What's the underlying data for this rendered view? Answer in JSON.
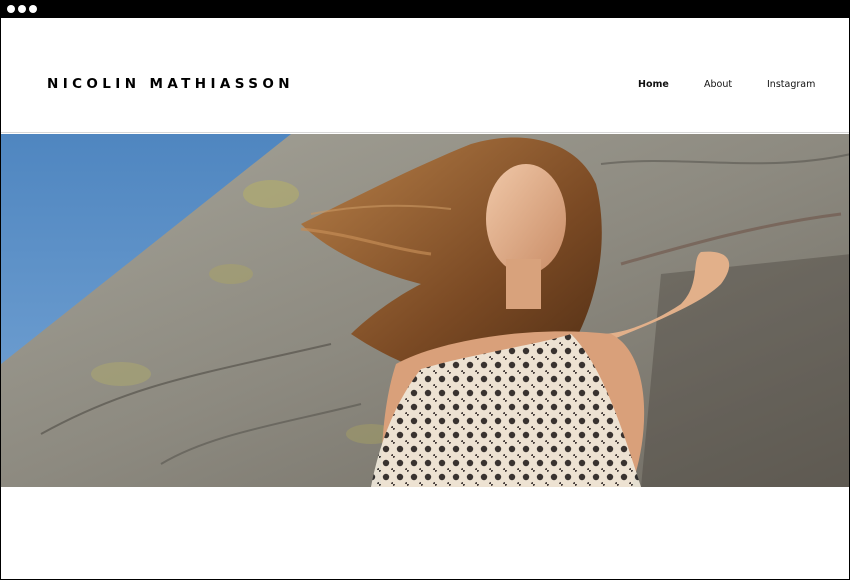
{
  "window": {
    "controls": [
      "window-dot",
      "window-dot",
      "window-dot"
    ]
  },
  "header": {
    "logo_text": "NICOLIN MATHIASSON",
    "nav": [
      {
        "label": "Home",
        "active": true
      },
      {
        "label": "About",
        "active": false
      },
      {
        "label": "Instagram",
        "active": false
      }
    ]
  },
  "hero": {
    "image": "model-on-rock-wall-photo",
    "colors": {
      "sky": "#5a8fc4",
      "rock": "#8f8d85",
      "hair": "#8a5a30",
      "lace": "#efe9dd"
    }
  }
}
